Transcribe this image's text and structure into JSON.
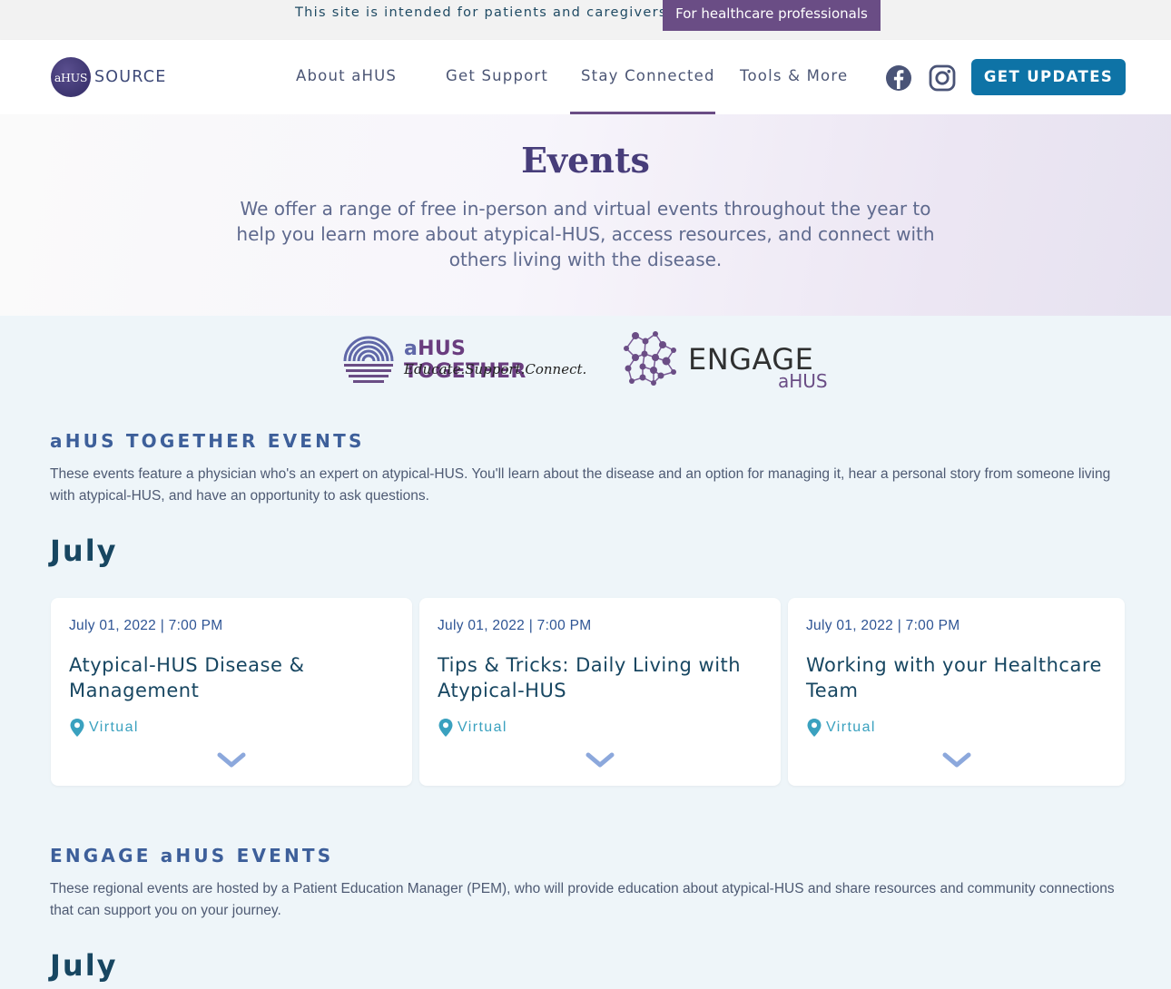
{
  "banner": {
    "notice": "This site is intended for patients and caregivers.",
    "hcp_label": "For healthcare professionals"
  },
  "header": {
    "logo_badge": "aHUS",
    "logo_text": "SOURCE",
    "nav": [
      {
        "label": "About aHUS"
      },
      {
        "label": "Get Support"
      },
      {
        "label": "Stay Connected",
        "active": true
      },
      {
        "label": "Tools & More"
      }
    ],
    "social_icons": [
      "facebook-icon",
      "instagram-icon"
    ],
    "cta_label": "GET UPDATES"
  },
  "hero": {
    "title": "Events",
    "description": "We offer a range of free in-person and virtual events throughout the year to help you learn more about atypical-HUS, access resources, and connect with others living with the disease."
  },
  "logos": {
    "together_prefix": "a",
    "together_name": "HUS TOGETHER",
    "together_tagline": "Educate.Support.Connect.",
    "engage_name": "ENGAGE",
    "engage_sub": "aHUS"
  },
  "together_section": {
    "heading": "aHUS TOGETHER EVENTS",
    "description": "These events feature a physician who's an expert on atypical-HUS. You'll learn about the disease and an option for managing it, hear a personal story from someone living with atypical-HUS, and have an opportunity to ask questions.",
    "month": "July",
    "events": [
      {
        "date": "July 01, 2022 | 7:00 PM",
        "title": "Atypical-HUS Disease & Management",
        "location": "Virtual"
      },
      {
        "date": "July 01, 2022 | 7:00 PM",
        "title": "Tips & Tricks: Daily Living with Atypical-HUS",
        "location": "Virtual"
      },
      {
        "date": "July 01, 2022 | 7:00 PM",
        "title": "Working with your Healthcare Team",
        "location": "Virtual"
      }
    ]
  },
  "engage_section": {
    "heading": "ENGAGE aHUS EVENTS",
    "description": "These regional events are hosted by a Patient Education Manager (PEM), who will provide education about atypical-HUS and share resources and community connections that can support you on your journey.",
    "month": "July"
  },
  "colors": {
    "accent_purple": "#6a4d85",
    "cta_blue": "#0e73a6",
    "heading_navy": "#174661",
    "location_teal": "#3aa1bf"
  }
}
